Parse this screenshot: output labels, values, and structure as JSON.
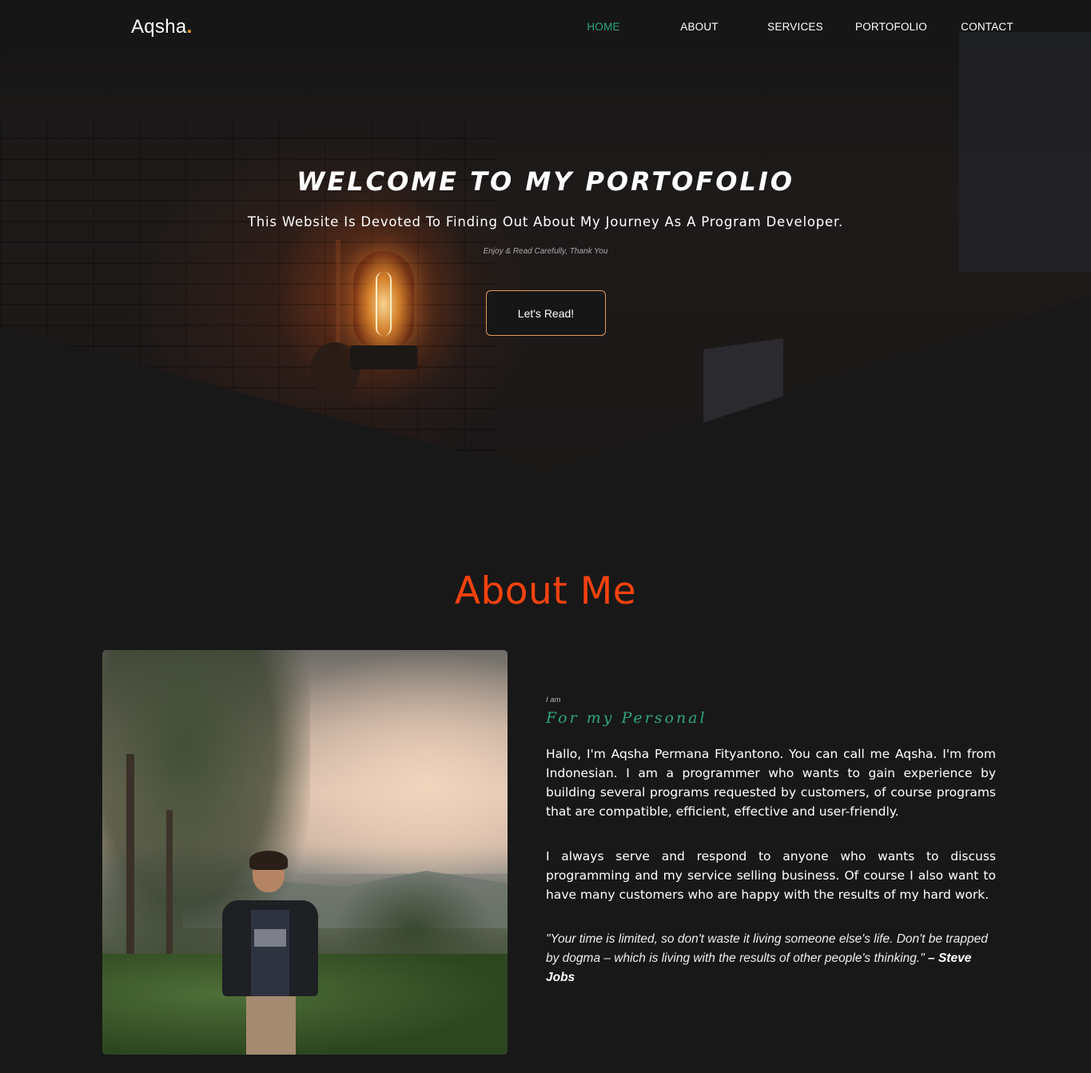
{
  "nav": {
    "logo": "Aqsha",
    "logo_dot": ".",
    "links": [
      {
        "label": "HOME",
        "active": true
      },
      {
        "label": "ABOUT",
        "active": false
      },
      {
        "label": "SERVICES",
        "active": false
      },
      {
        "label": "PORTOFOLIO",
        "active": false
      },
      {
        "label": "CONTACT",
        "active": false
      }
    ]
  },
  "hero": {
    "title": "WELCOME TO MY PORTOFOLIO",
    "subtitle": "This Website Is Devoted To Finding Out About My Journey As A Program Developer.",
    "note": "Enjoy & Read Carefully, Thank You",
    "button_label": "Let's Read!"
  },
  "about": {
    "title": "About Me",
    "i_am": "I am",
    "tagline": "For my Personal",
    "paragraph1": "Hallo, I'm Aqsha Permana Fityantono. You can call me Aqsha. I'm from Indonesian. I am a programmer who wants to gain experience by building several programs requested by customers, of course programs that are compatible, efficient, effective and user-friendly.",
    "paragraph2": "I always serve and respond to anyone who wants to discuss programming and my service selling business. Of course I also want to have many customers who are happy with the results of my hard work.",
    "quote": "\"Your time is limited, so don't waste it living someone else's life. Don't be trapped by dogma – which is living with the results of other people's thinking.\"",
    "quote_author": "– Steve Jobs"
  },
  "colors": {
    "background": "#181818",
    "accent_green": "#2fa57a",
    "accent_orange": "#f7420f",
    "logo_dot": "#f9a11b",
    "button_border": "#e59b5a"
  }
}
